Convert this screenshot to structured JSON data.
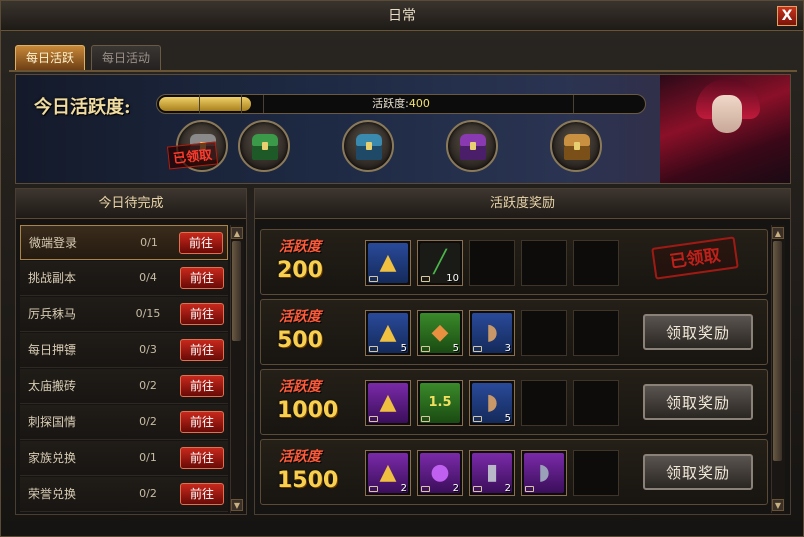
{
  "window": {
    "title": "日常",
    "close": "X"
  },
  "tabs": [
    {
      "label": "每日活跃",
      "active": true
    },
    {
      "label": "每日活动",
      "active": false
    }
  ],
  "banner": {
    "label": "今日活跃度:",
    "progress_label": "活跃度:",
    "progress_value": "400",
    "progress_fraction": 0.19,
    "claimed_text": "已领取",
    "chests": [
      "chest-gray",
      "chest-green",
      "chest-blue",
      "chest-purple",
      "chest-gold"
    ]
  },
  "left_panel": {
    "title": "今日待完成",
    "go_label": "前往",
    "tasks": [
      {
        "name": "微端登录",
        "count": "0/1",
        "selected": true
      },
      {
        "name": "挑战副本",
        "count": "0/4"
      },
      {
        "name": "厉兵秣马",
        "count": "0/15"
      },
      {
        "name": "每日押镖",
        "count": "0/3"
      },
      {
        "name": "太庙搬砖",
        "count": "0/2"
      },
      {
        "name": "刺探国情",
        "count": "0/2"
      },
      {
        "name": "家族兑换",
        "count": "0/1"
      },
      {
        "name": "荣誉兑换",
        "count": "0/2"
      }
    ]
  },
  "right_panel": {
    "title": "活跃度奖励",
    "tier_label": "活跃度",
    "claim_label": "领取奖励",
    "claimed_stamp": "已领取",
    "tiers": [
      {
        "points": "200",
        "claimed": true,
        "items": [
          {
            "icon": "gold-ingot-icon",
            "qty": ""
          },
          {
            "icon": "green-sword-icon",
            "qty": "10"
          }
        ]
      },
      {
        "points": "500",
        "claimed": false,
        "items": [
          {
            "icon": "gold-ingot-icon",
            "qty": "5"
          },
          {
            "icon": "token-icon",
            "qty": "5"
          },
          {
            "icon": "war-fan-icon",
            "qty": "3"
          }
        ]
      },
      {
        "points": "1000",
        "claimed": false,
        "items": [
          {
            "icon": "gold-ingot-icon",
            "qty": ""
          },
          {
            "icon": "exp-book-icon",
            "qty": "",
            "label": "1.5"
          },
          {
            "icon": "war-fan-icon",
            "qty": "5"
          }
        ]
      },
      {
        "points": "1500",
        "claimed": false,
        "items": [
          {
            "icon": "gold-ingot-icon",
            "qty": "2"
          },
          {
            "icon": "purple-orb-icon",
            "qty": "2"
          },
          {
            "icon": "purple-scroll-icon",
            "qty": "2"
          },
          {
            "icon": "purple-fan-icon",
            "qty": ""
          }
        ]
      }
    ]
  },
  "colors": {
    "accent_gold": "#f8d050",
    "accent_red": "#c8281c",
    "chest_gray": "#8a8a8a",
    "chest_green": "#3a9a4a",
    "chest_blue": "#3a8ab0",
    "chest_purple": "#8a3ab0",
    "chest_gold": "#c89040"
  }
}
